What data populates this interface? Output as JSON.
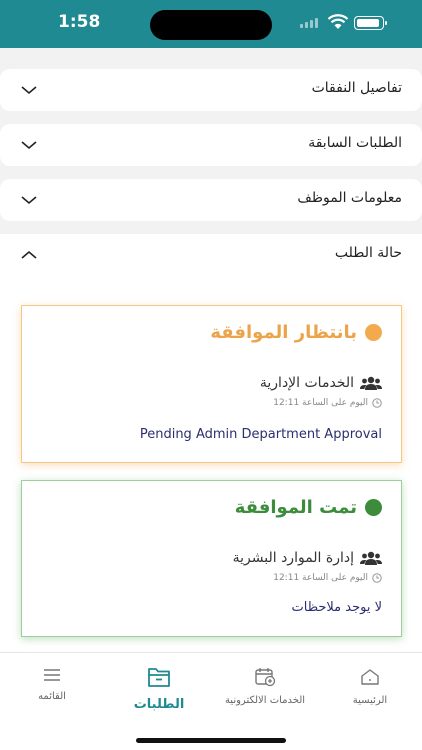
{
  "status_bar": {
    "time": "1:58"
  },
  "accordions": [
    {
      "label": "تفاصيل النفقات",
      "expanded": false
    },
    {
      "label": "الطلبات السابقة",
      "expanded": false
    },
    {
      "label": "معلومات الموظف",
      "expanded": false
    },
    {
      "label": "حالة الطلب",
      "expanded": true
    }
  ],
  "request_status": {
    "cards": [
      {
        "status": "بانتظار الموافقة",
        "status_color": "#eba44a",
        "department": "الخدمات الإدارية",
        "time": "اليوم على الساعة 12:11",
        "note": "Pending Admin Department Approval"
      },
      {
        "status": "تمت الموافقة",
        "status_color": "#3c8c3c",
        "department": "إدارة الموارد البشرية",
        "time": "اليوم على الساعة 12:11",
        "note": "لا يوجد ملاحظات"
      }
    ]
  },
  "tab_bar": {
    "accent_color": "#1f8a91",
    "tabs": [
      {
        "label": "القائمه",
        "icon": "menu-icon",
        "active": false
      },
      {
        "label": "الطلبات",
        "icon": "folder-icon",
        "active": true
      },
      {
        "label": "الخدمات الالكترونية",
        "icon": "calendar-add-icon",
        "active": false
      },
      {
        "label": "الرئيسية",
        "icon": "home-icon",
        "active": false
      }
    ]
  }
}
